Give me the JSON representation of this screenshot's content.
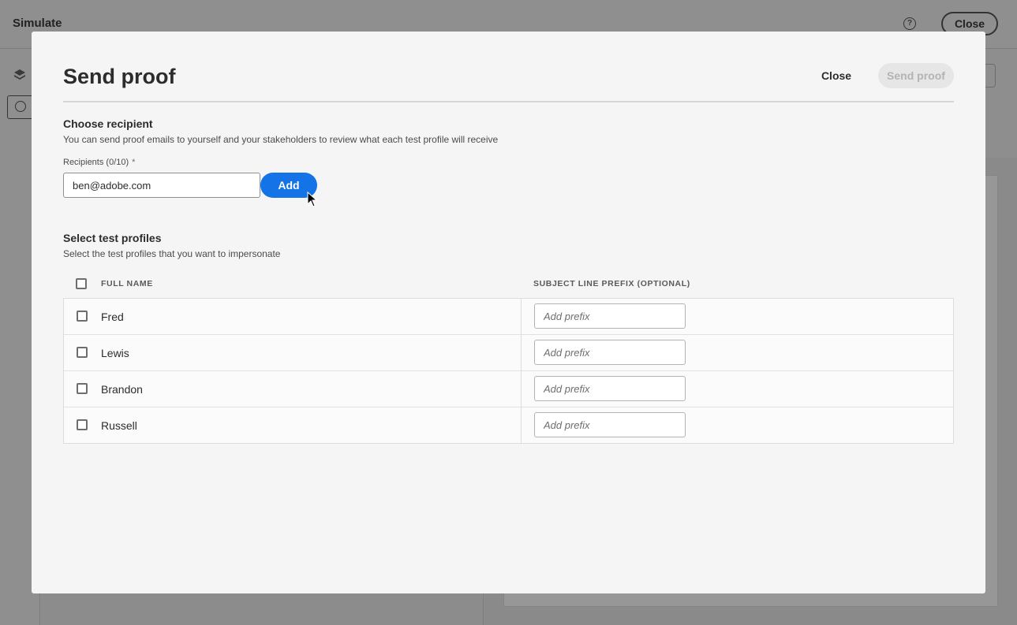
{
  "background": {
    "title": "Simulate",
    "help_icon": "help-circle-icon",
    "close_label": "Close"
  },
  "modal": {
    "title": "Send proof",
    "close_label": "Close",
    "send_label": "Send proof",
    "recipient": {
      "title": "Choose recipient",
      "description": "You can send proof emails to yourself and your stakeholders to review what each test profile will receive",
      "field_label": "Recipients (0/10)",
      "required_mark": "*",
      "email_value": "ben@adobe.com",
      "add_label": "Add"
    },
    "profiles": {
      "title": "Select test profiles",
      "description": "Select the test profiles that you want to impersonate",
      "col_name": "FULL NAME",
      "col_prefix": "SUBJECT LINE PREFIX (OPTIONAL)",
      "prefix_placeholder": "Add prefix",
      "rows": [
        {
          "name": "Fred"
        },
        {
          "name": "Lewis"
        },
        {
          "name": "Brandon"
        },
        {
          "name": "Russell"
        }
      ]
    }
  },
  "colors": {
    "accent": "#1473e6",
    "overlay": "#8e8e8e",
    "modal_bg": "#f5f5f5"
  }
}
